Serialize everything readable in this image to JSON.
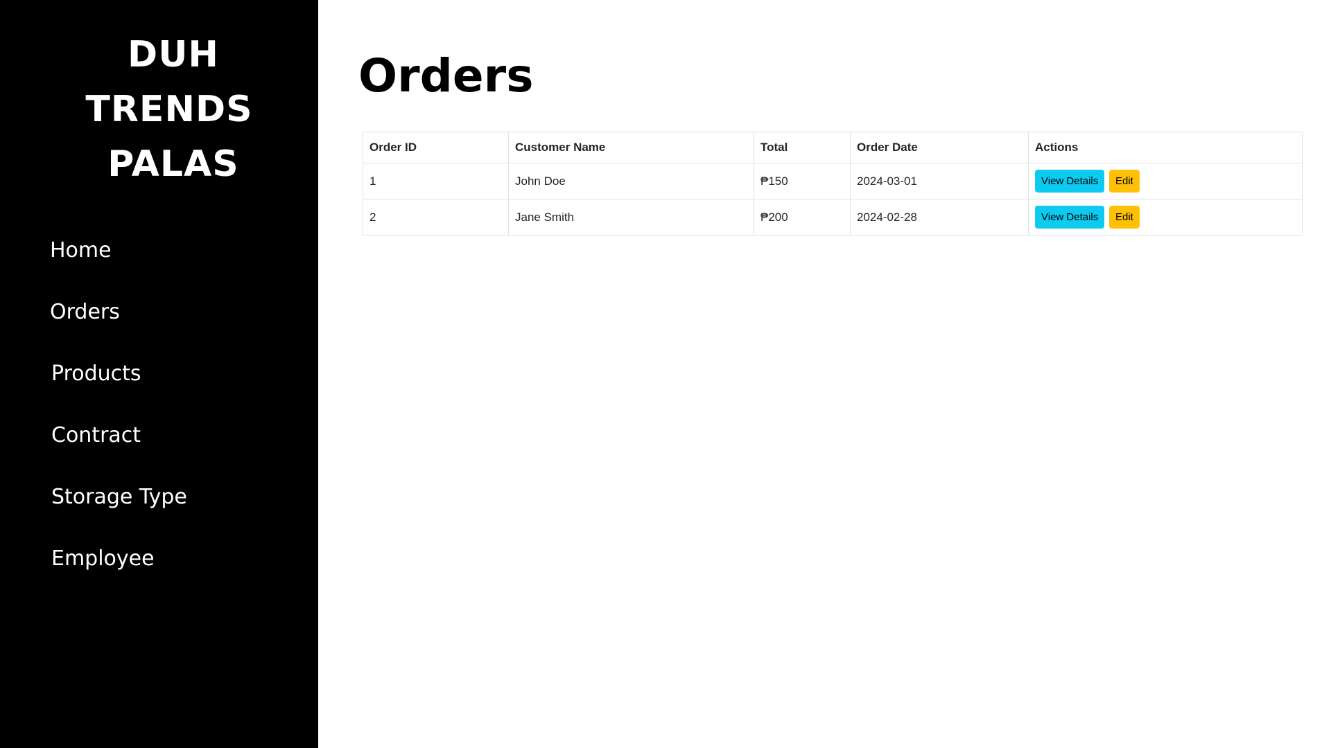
{
  "brand": {
    "line1": "DUH",
    "line2": "TRENDS",
    "line3": "PALAS"
  },
  "sidebar": {
    "items": [
      {
        "label": "Home"
      },
      {
        "label": "Orders"
      },
      {
        "label": "Products"
      },
      {
        "label": "Contract"
      },
      {
        "label": "Storage Type"
      },
      {
        "label": "Employee"
      }
    ]
  },
  "main": {
    "title": "Orders",
    "table": {
      "headers": [
        "Order ID",
        "Customer Name",
        "Total",
        "Order Date",
        "Actions"
      ],
      "rows": [
        {
          "id": "1",
          "customer": "John Doe",
          "total": "₱150",
          "date": "2024-03-01",
          "view_label": "View Details",
          "edit_label": "Edit"
        },
        {
          "id": "2",
          "customer": "Jane Smith",
          "total": "₱200",
          "date": "2024-02-28",
          "view_label": "View Details",
          "edit_label": "Edit"
        }
      ]
    }
  },
  "colors": {
    "sidebar_bg": "#000000",
    "view_button": "#0dcaf0",
    "edit_button": "#ffc107",
    "table_border": "#dee2e6"
  }
}
